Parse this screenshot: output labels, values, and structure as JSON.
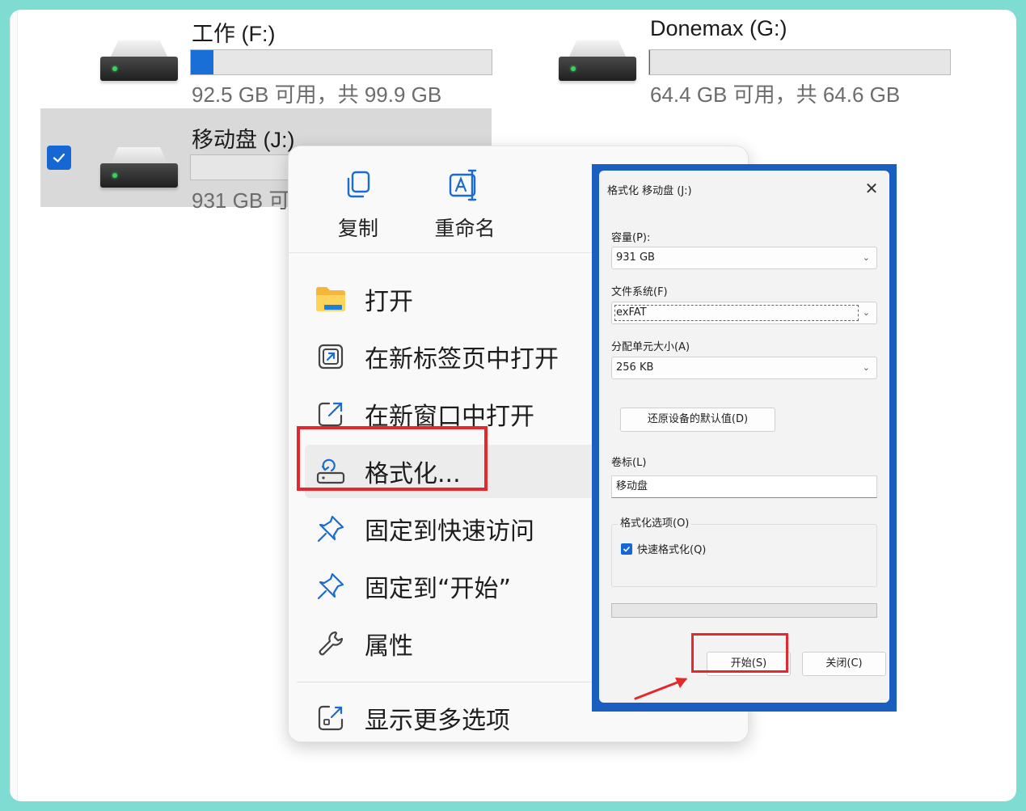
{
  "drives": [
    {
      "name": "工作 (F:)",
      "size_text": "92.5 GB 可用，共 99.9 GB",
      "used_fraction": 0.074
    },
    {
      "name": "Donemax (G:)",
      "size_text": "64.4 GB 可用，共 64.6 GB",
      "used_fraction": 0.003
    },
    {
      "name": "移动盘 (J:)",
      "size_text": "931 GB 可",
      "used_fraction": 0.0,
      "selected": true
    }
  ],
  "context_menu": {
    "quick_actions": [
      {
        "label": "复制",
        "icon": "copy-icon"
      },
      {
        "label": "重命名",
        "icon": "rename-icon"
      }
    ],
    "items": [
      {
        "label": "打开",
        "icon": "folder-icon"
      },
      {
        "label": "在新标签页中打开",
        "icon": "new-tab-icon"
      },
      {
        "label": "在新窗口中打开",
        "icon": "new-window-icon"
      },
      {
        "label": "格式化...",
        "icon": "format-icon",
        "highlighted": true
      },
      {
        "label": "固定到快速访问",
        "icon": "pin-icon"
      },
      {
        "label": "固定到“开始”",
        "icon": "pin-icon"
      },
      {
        "label": "属性",
        "icon": "wrench-icon"
      },
      {
        "label": "显示更多选项",
        "icon": "more-options-icon"
      }
    ]
  },
  "format_dialog": {
    "title": "格式化 移动盘 (J:)",
    "close_glyph": "✕",
    "capacity_label": "容量(P):",
    "capacity_value": "931 GB",
    "filesystem_label": "文件系统(F)",
    "filesystem_value": "exFAT",
    "alloc_label": "分配单元大小(A)",
    "alloc_value": "256 KB",
    "restore_button": "还原设备的默认值(D)",
    "volume_label_label": "卷标(L)",
    "volume_label_value": "移动盘",
    "options_label": "格式化选项(O)",
    "quick_format_label": "快速格式化(Q)",
    "quick_format_checked": true,
    "start_button": "开始(S)",
    "close_button": "关闭(C)"
  },
  "colors": {
    "accent": "#1667d3",
    "highlight_red": "#e5282b",
    "dialog_frame": "#1a5fbf",
    "page_border": "#7fdcd2"
  }
}
